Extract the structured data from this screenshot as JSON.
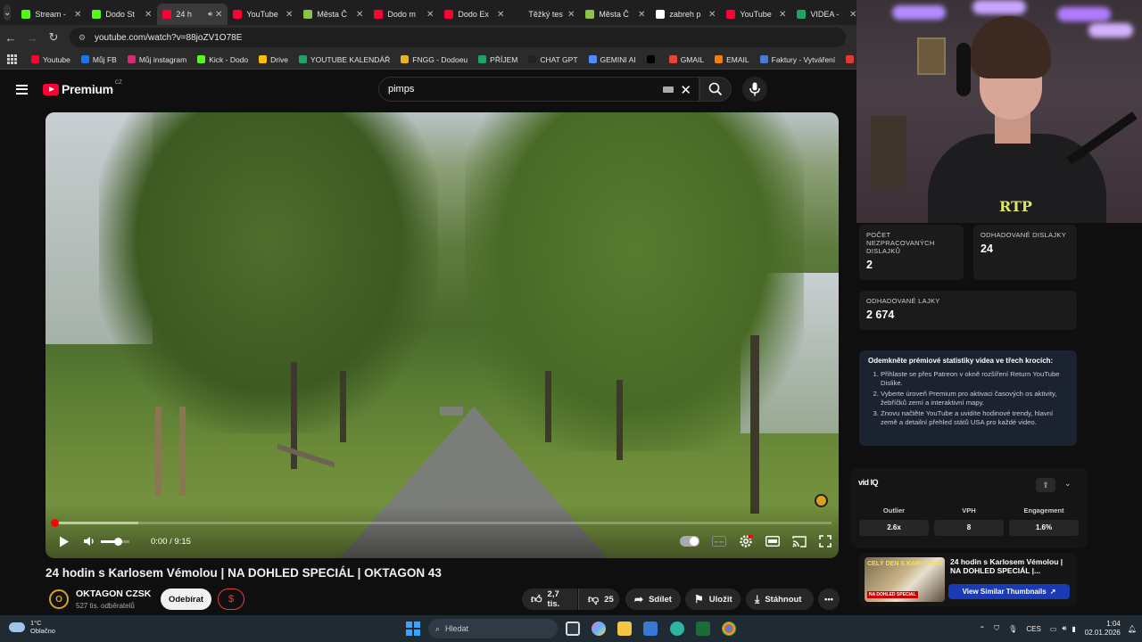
{
  "tabs": [
    {
      "label": "Stream -",
      "icon": "kick-icon",
      "color": "#53fc18",
      "active": false
    },
    {
      "label": "Dodo St",
      "icon": "kick-icon",
      "color": "#53fc18",
      "active": false
    },
    {
      "label": "24 h",
      "icon": "youtube-icon",
      "color": "#ff0033",
      "active": true
    },
    {
      "label": "YouTube",
      "icon": "youtube-icon",
      "color": "#ff0033",
      "active": false
    },
    {
      "label": "Města Č",
      "icon": "globe-icon",
      "color": "#8bc34a",
      "active": false
    },
    {
      "label": "Dodo m",
      "icon": "youtube-icon",
      "color": "#ff0033",
      "active": false
    },
    {
      "label": "Dodo Ex",
      "icon": "youtube-icon",
      "color": "#ff0033",
      "active": false
    },
    {
      "label": "Těžký tes",
      "icon": "page-icon",
      "color": "#1f1f1f",
      "active": false
    },
    {
      "label": "Města Č",
      "icon": "globe-icon",
      "color": "#8bc34a",
      "active": false
    },
    {
      "label": "zabreh p",
      "icon": "google-icon",
      "color": "#ffffff",
      "active": false
    },
    {
      "label": "YouTube",
      "icon": "youtube-icon",
      "color": "#ff0033",
      "active": false
    },
    {
      "label": "VIDEA -",
      "icon": "sheets-icon",
      "color": "#1fa463",
      "active": false
    }
  ],
  "address": {
    "url": "youtube.com/watch?v=88joZV1O78E"
  },
  "bookmarks": [
    {
      "label": "Youtube",
      "color": "#ff0033"
    },
    {
      "label": "Můj FB",
      "color": "#1877f2"
    },
    {
      "label": "Můj instagram",
      "color": "#d62976"
    },
    {
      "label": "Kick - Dodo",
      "color": "#53fc18"
    },
    {
      "label": "Drive",
      "color": "#fbbc04"
    },
    {
      "label": "YOUTUBE KALENDÁŘ",
      "color": "#1fa463"
    },
    {
      "label": "FNGG - Dodoeu",
      "color": "#e6b422"
    },
    {
      "label": "PŘÍJEM",
      "color": "#1fa463"
    },
    {
      "label": "CHAT GPT",
      "color": "#222222"
    },
    {
      "label": "GEMINI AI",
      "color": "#4e8cff"
    },
    {
      "label": "",
      "color": "#000000"
    },
    {
      "label": "GMAIL",
      "color": "#ea4335"
    },
    {
      "label": "EMAIL",
      "color": "#ff7a00"
    },
    {
      "label": "Faktury - Vytváření",
      "color": "#4a7bd0"
    },
    {
      "label": "PNG to PDF",
      "color": "#e53935"
    }
  ],
  "header": {
    "brand": "Premium",
    "region": "CZ",
    "search_value": "pimps"
  },
  "player": {
    "time": "0:00 / 9:15",
    "progress_fraction": 0.0,
    "buffer_fraction": 0.11
  },
  "video": {
    "title": "24 hodin s Karlosem Vémolou | NA DOHLED SPECIÁL | OKTAGON 43",
    "channel": "OKTAGON CZSK",
    "subscribers": "527 tis. odběratelů",
    "subscribe_label": "Odebírat",
    "likes": "2,7 tis.",
    "dislikes": "25",
    "share_label": "Sdílet",
    "save_label": "Uložit",
    "download_label": "Stáhnout"
  },
  "stats": {
    "unprocessed_label": "POČET NEZPRACOVANÝCH DISLAJKŮ",
    "unprocessed_value": "2",
    "est_dislikes_label": "ODHADOVANÉ DISLAJKY",
    "est_dislikes_value": "24",
    "est_likes_label": "ODHADOVANÉ LAJKY",
    "est_likes_value": "2 674"
  },
  "premium": {
    "heading": "Odemkněte prémiové statistiky videa ve třech krocích:",
    "steps": [
      "Přihlaste se přes Patreon v okně rozšíření Return YouTube Dislike.",
      "Vyberte úroveň Premium pro aktivaci časových os aktivity, žebříčků zemí a interaktivní mapy.",
      "Znovu načtěte YouTube a uvidíte hodinové trendy, hlavní země a detailní přehled států USA pro každé video."
    ]
  },
  "vidiq": {
    "logo": "vid IQ",
    "metrics": [
      {
        "label": "Outlier",
        "value": "2.6x"
      },
      {
        "label": "VPH",
        "value": "8"
      },
      {
        "label": "Engagement",
        "value": "1.6%"
      }
    ]
  },
  "similar": {
    "title": "24 hodin s Karlosem Vémolou | NA DOHLED SPECIÁL |...",
    "thumb_text": "CELÝ DEN S KARLOSEM",
    "thumb_tag": "NA DOHLED SPECIAL",
    "button": "View Similar Thumbnails"
  },
  "taskbar": {
    "temp": "1°C",
    "weather": "Oblačno",
    "search_placeholder": "Hledat",
    "lang": "CES",
    "time": "1:04",
    "date": "02.01.2026"
  }
}
